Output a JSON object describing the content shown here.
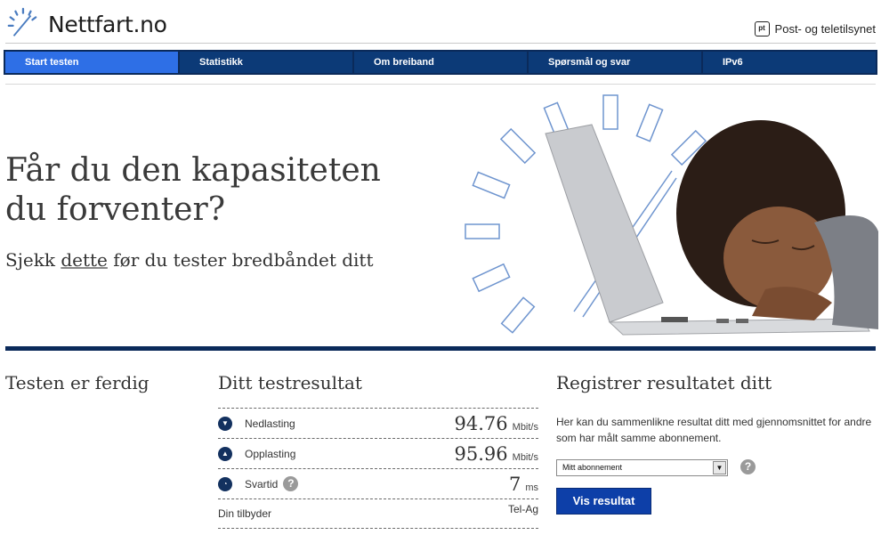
{
  "header": {
    "logo_text": "Nettfart.no",
    "agency_badge": "pt",
    "agency_name": "Post- og teletilsynet"
  },
  "nav": {
    "items": [
      "Start testen",
      "Statistikk",
      "Om breiband",
      "Spørsmål og svar",
      "IPv6"
    ],
    "active_index": 0
  },
  "hero": {
    "title_line1": "Får du den kapasiteten",
    "title_line2": "du forventer?",
    "sub_before": "Sjekk ",
    "sub_link": "dette",
    "sub_after": " før du tester bredbåndet ditt"
  },
  "status": {
    "heading": "Testen er ferdig"
  },
  "results": {
    "heading": "Ditt testresultat",
    "download": {
      "label": "Nedlasting",
      "value": "94.76",
      "unit": "Mbit/s",
      "icon": "download-arrow-icon"
    },
    "upload": {
      "label": "Opplasting",
      "value": "95.96",
      "unit": "Mbit/s",
      "icon": "upload-arrow-icon"
    },
    "latency": {
      "label": "Svartid",
      "value": "7",
      "unit": "ms",
      "icon": "clock-icon"
    },
    "provider": {
      "label": "Din tilbyder",
      "value": "Tel-Ag"
    }
  },
  "register": {
    "heading": "Registrer resultatet ditt",
    "text": "Her kan du sammenlikne resultat ditt med gjennomsnittet for andre som har målt samme abonnement.",
    "select_value": "Mitt abonnement",
    "button_label": "Vis resultat"
  },
  "colors": {
    "nav_bg": "#0b2a5a",
    "nav_active": "#2e6fe6",
    "button": "#0d3fa8"
  }
}
